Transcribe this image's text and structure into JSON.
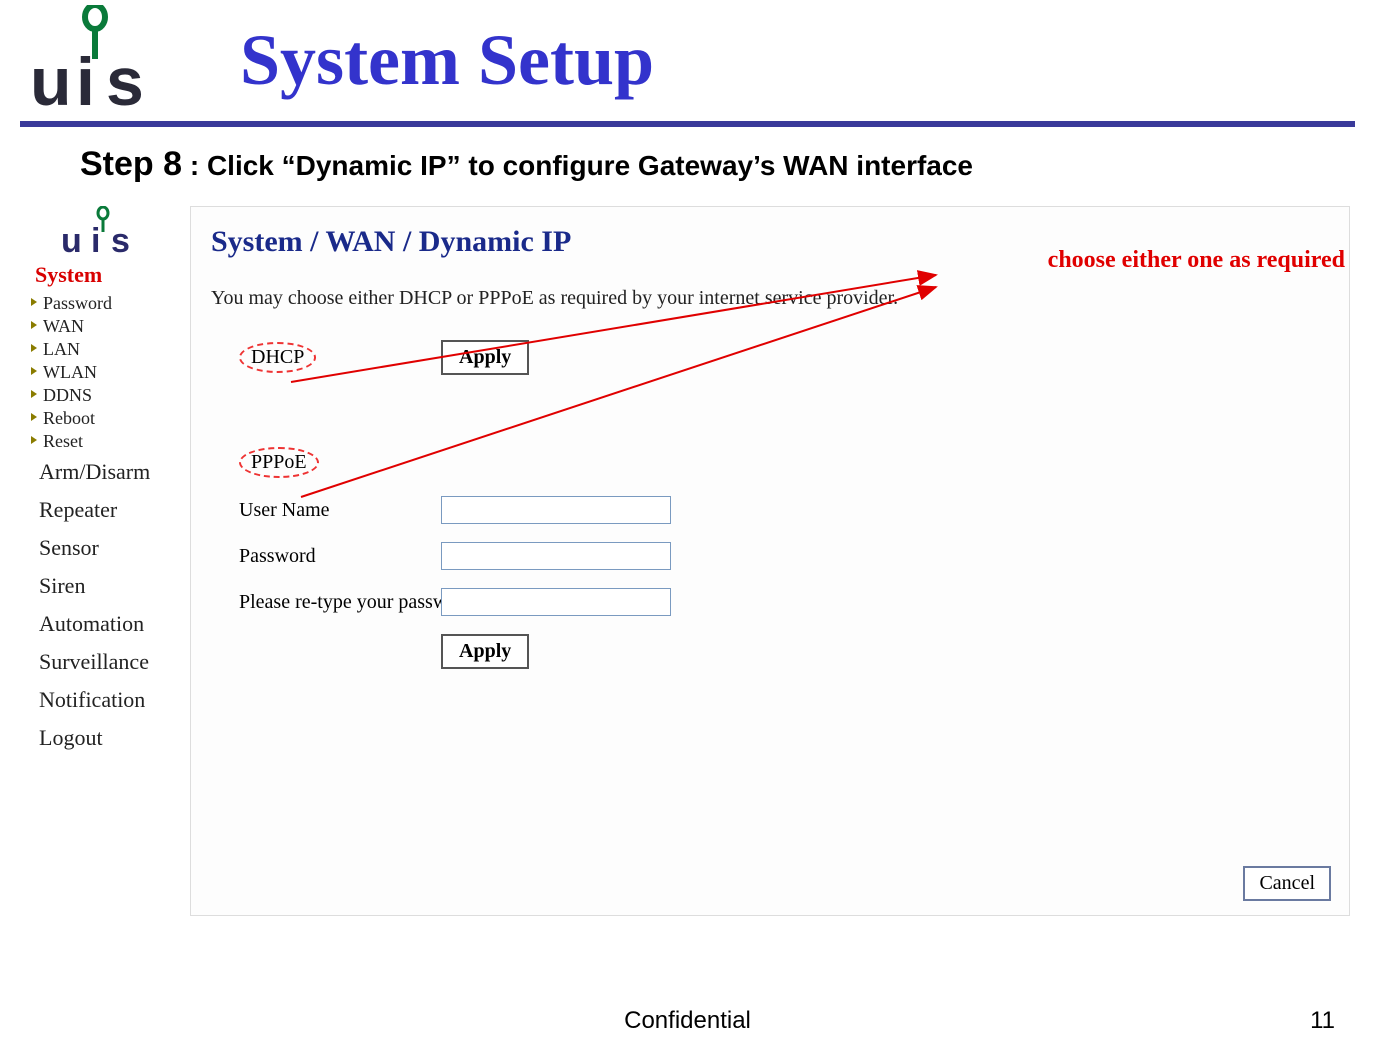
{
  "slide": {
    "title": "System Setup",
    "step_label": "Step 8",
    "step_sep": " : ",
    "step_text": "Click “Dynamic IP” to configure Gateway’s WAN interface",
    "annotation": "choose either one as required",
    "footer_confidential": "Confidential",
    "footer_page": "11"
  },
  "sidebar": {
    "system_label": "System",
    "sub_items": [
      "Password",
      "WAN",
      "LAN",
      "WLAN",
      "DDNS",
      "Reboot",
      "Reset"
    ],
    "main_items": [
      "Arm/Disarm",
      "Repeater",
      "Sensor",
      "Siren",
      "Automation",
      "Surveillance",
      "Notification",
      "Logout"
    ]
  },
  "panel": {
    "breadcrumb": "System / WAN / Dynamic IP",
    "description": "You may choose either DHCP or PPPoE as required by your internet service provider.",
    "dhcp_label": "DHCP",
    "pppoe_label": "PPPoE",
    "apply_label": "Apply",
    "username_label": "User Name",
    "password_label": "Password",
    "retype_label": "Please re-type your password",
    "cancel_label": "Cancel"
  }
}
